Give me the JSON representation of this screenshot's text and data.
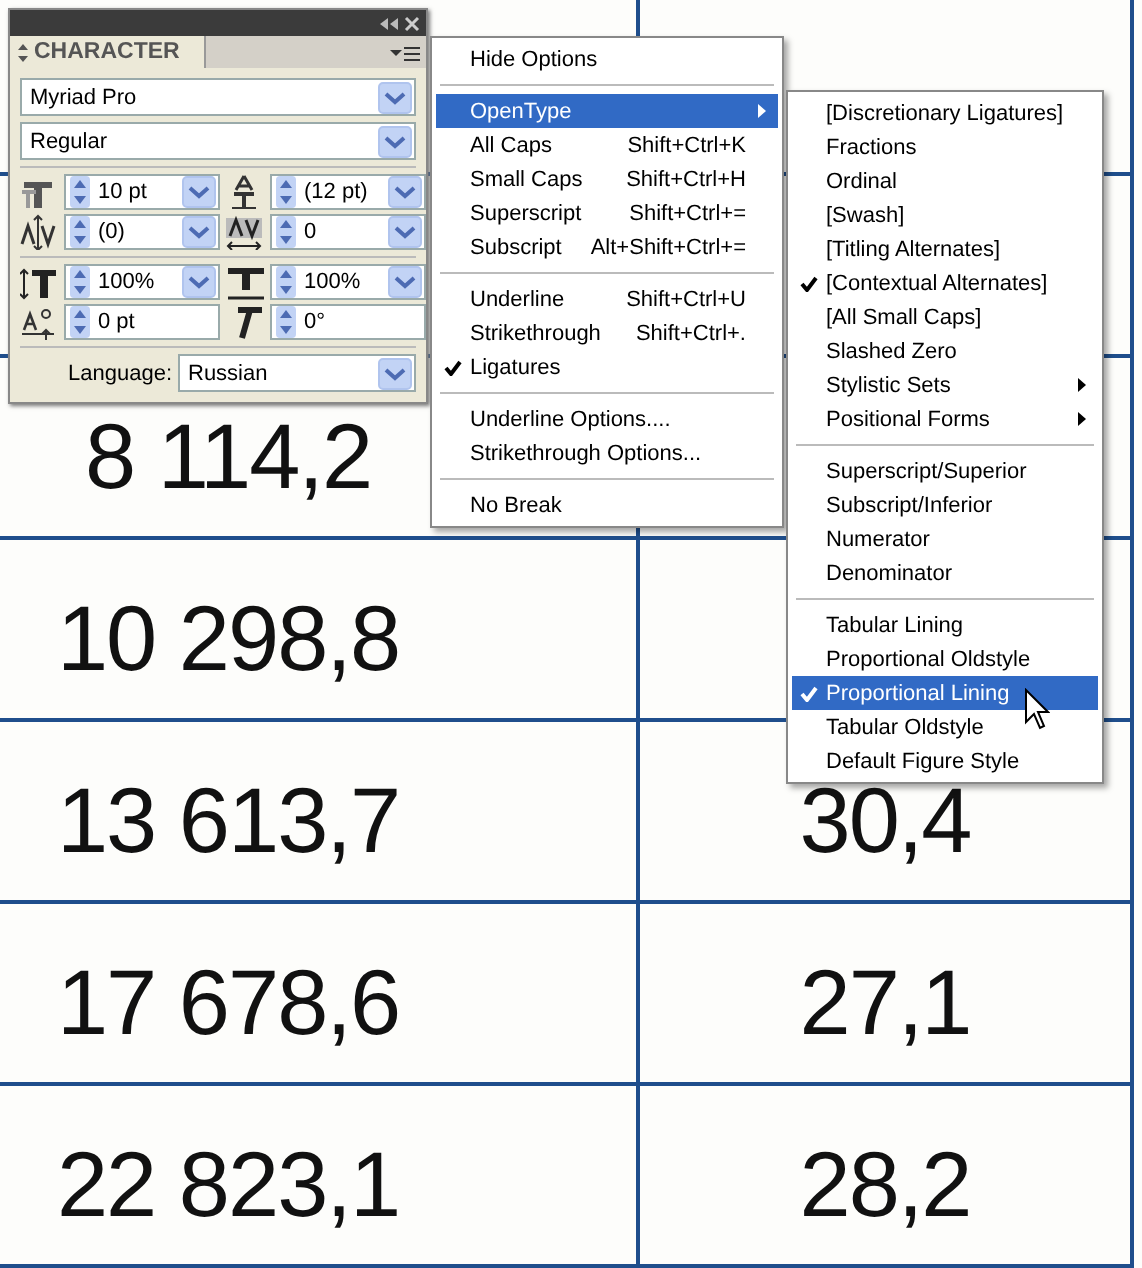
{
  "table": {
    "rows": [
      {},
      {},
      {
        "column_1": "8 114,2"
      },
      {
        "column_1": "10 298,8"
      },
      {
        "column_1": "13 613,7",
        "column_2": "30,4"
      },
      {
        "column_1": "17 678,6",
        "column_2": "27,1"
      },
      {
        "column_1": "22 823,1",
        "column_2": "28,2"
      }
    ]
  },
  "character_panel": {
    "title": "CHARACTER",
    "font_family": "Myriad Pro",
    "font_style": "Regular",
    "fields": [
      {
        "kind": "size",
        "value": "10 pt",
        "dropdown": true
      },
      {
        "kind": "leading",
        "value": "(12 pt)",
        "dropdown": true
      },
      {
        "kind": "kerning",
        "value": "(0)",
        "dropdown": true
      },
      {
        "kind": "tracking",
        "value": "0",
        "dropdown": true
      },
      {
        "kind": "vertical-scale",
        "value": "100%",
        "dropdown": true
      },
      {
        "kind": "horizontal-scale",
        "value": "100%",
        "dropdown": true
      },
      {
        "kind": "baseline-shift",
        "value": "0 pt",
        "dropdown": false
      },
      {
        "kind": "skew",
        "value": "0°",
        "dropdown": false
      }
    ],
    "language_label": "Language:",
    "language": "Russian"
  },
  "menu": {
    "groups": [
      [
        {
          "label": "Hide Options",
          "checked": false,
          "selected": false,
          "submenu": false
        }
      ],
      [
        {
          "label": "OpenType",
          "checked": false,
          "selected": true,
          "submenu": true
        },
        {
          "label": "All Caps",
          "shortcut": "Shift+Ctrl+K",
          "checked": false,
          "selected": false,
          "submenu": false
        },
        {
          "label": "Small Caps",
          "shortcut": "Shift+Ctrl+H",
          "checked": false,
          "selected": false,
          "submenu": false
        },
        {
          "label": "Superscript",
          "shortcut": "Shift+Ctrl+=",
          "checked": false,
          "selected": false,
          "submenu": false
        },
        {
          "label": "Subscript",
          "shortcut": "Alt+Shift+Ctrl+=",
          "checked": false,
          "selected": false,
          "submenu": false
        }
      ],
      [
        {
          "label": "Underline",
          "shortcut": "Shift+Ctrl+U",
          "checked": false,
          "selected": false,
          "submenu": false
        },
        {
          "label": "Strikethrough",
          "shortcut": "Shift+Ctrl+.",
          "checked": false,
          "selected": false,
          "submenu": false
        },
        {
          "label": "Ligatures",
          "checked": true,
          "selected": false,
          "submenu": false
        }
      ],
      [
        {
          "label": "Underline Options....",
          "checked": false,
          "selected": false,
          "submenu": false
        },
        {
          "label": "Strikethrough Options...",
          "checked": false,
          "selected": false,
          "submenu": false
        }
      ],
      [
        {
          "label": "No Break",
          "checked": false,
          "selected": false,
          "submenu": false
        }
      ]
    ]
  },
  "submenu": {
    "groups": [
      [
        {
          "label": "[Discretionary Ligatures]",
          "checked": false,
          "selected": false,
          "submenu": false
        },
        {
          "label": "Fractions",
          "checked": false,
          "selected": false,
          "submenu": false
        },
        {
          "label": "Ordinal",
          "checked": false,
          "selected": false,
          "submenu": false
        },
        {
          "label": "[Swash]",
          "checked": false,
          "selected": false,
          "submenu": false
        },
        {
          "label": "[Titling Alternates]",
          "checked": false,
          "selected": false,
          "submenu": false
        },
        {
          "label": "[Contextual Alternates]",
          "checked": true,
          "selected": false,
          "submenu": false
        },
        {
          "label": "[All Small Caps]",
          "checked": false,
          "selected": false,
          "submenu": false
        },
        {
          "label": "Slashed Zero",
          "checked": false,
          "selected": false,
          "submenu": false
        },
        {
          "label": "Stylistic Sets",
          "checked": false,
          "selected": false,
          "submenu": true
        },
        {
          "label": "Positional Forms",
          "checked": false,
          "selected": false,
          "submenu": true
        }
      ],
      [
        {
          "label": "Superscript/Superior",
          "checked": false,
          "selected": false,
          "submenu": false
        },
        {
          "label": "Subscript/Inferior",
          "checked": false,
          "selected": false,
          "submenu": false
        },
        {
          "label": "Numerator",
          "checked": false,
          "selected": false,
          "submenu": false
        },
        {
          "label": "Denominator",
          "checked": false,
          "selected": false,
          "submenu": false
        }
      ],
      [
        {
          "label": "Tabular Lining",
          "checked": false,
          "selected": false,
          "submenu": false
        },
        {
          "label": "Proportional Oldstyle",
          "checked": false,
          "selected": false,
          "submenu": false
        },
        {
          "label": "Proportional Lining",
          "checked": true,
          "selected": true,
          "submenu": false
        },
        {
          "label": "Tabular Oldstyle",
          "checked": false,
          "selected": false,
          "submenu": false
        },
        {
          "label": "Default Figure Style",
          "checked": false,
          "selected": false,
          "submenu": false
        }
      ]
    ]
  }
}
